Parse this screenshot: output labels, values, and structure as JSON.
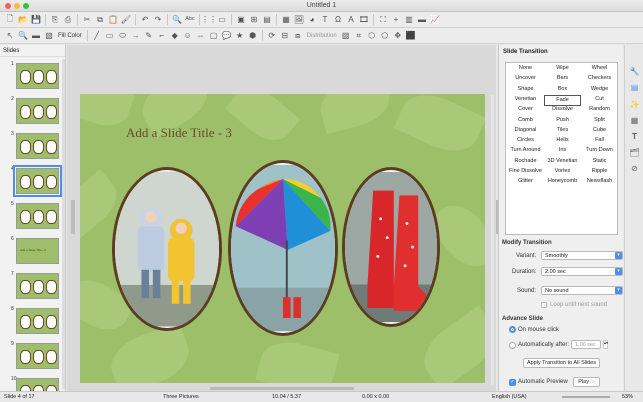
{
  "window": {
    "title": "Untitled 1"
  },
  "toolbar2": {
    "fill_label": "Fill Color",
    "distribution_label": "Distribution"
  },
  "slides_pane": {
    "header": "Slides",
    "slides": [
      {
        "num": "1"
      },
      {
        "num": "2"
      },
      {
        "num": "3"
      },
      {
        "num": "4"
      },
      {
        "num": "5"
      },
      {
        "num": "6",
        "thumb_text": "Add a Slide Title - 6"
      },
      {
        "num": "7"
      },
      {
        "num": "8"
      },
      {
        "num": "9"
      },
      {
        "num": "10"
      }
    ]
  },
  "slide": {
    "title": "Add a Slide Title - 3"
  },
  "sidebar": {
    "header": "Slide Transition",
    "transitions": [
      "None",
      "Wipe",
      "Wheel",
      "Uncover",
      "Bars",
      "Checkers",
      "Shape",
      "Box",
      "Wedge",
      "Venetian",
      "Fade",
      "Cut",
      "Cover",
      "Dissolve",
      "Random",
      "Comb",
      "Push",
      "Split",
      "Diagonal",
      "Tiles",
      "Cube",
      "Circles",
      "Helix",
      "Fall",
      "Turn Around",
      "Iris",
      "Turn Down",
      "Rochade",
      "3D Venetian",
      "Static",
      "Fine Dissolve",
      "Vortex",
      "Ripple",
      "Glitter",
      "Honeycomb",
      "Newsflash"
    ],
    "selected": "Fade",
    "modify_header": "Modify Transition",
    "variant_label": "Variant:",
    "variant_value": "Smoothly",
    "duration_label": "Duration:",
    "duration_value": "2.00 sec",
    "sound_label": "Sound:",
    "sound_value": "No sound",
    "loop_label": "Loop until next sound",
    "advance_header": "Advance Slide",
    "on_click_label": "On mouse click",
    "auto_label": "Automatically after:",
    "auto_value": "1.00 sec",
    "apply_all_label": "Apply Transition to All Slides",
    "auto_preview_label": "Automatic Preview",
    "play_label": "Play"
  },
  "status": {
    "slide_info": "Slide 4 of 17",
    "layout": "Three Pictures",
    "position": "10.04 / 5.37",
    "size": "0.00 x 0.00",
    "language": "English (USA)",
    "zoom": "53%"
  },
  "colors": {
    "accent": "#4b8ef0",
    "slide_bg": "#9dbf6a",
    "title_color": "#6a4b2a",
    "frame": "#5b3d22"
  }
}
